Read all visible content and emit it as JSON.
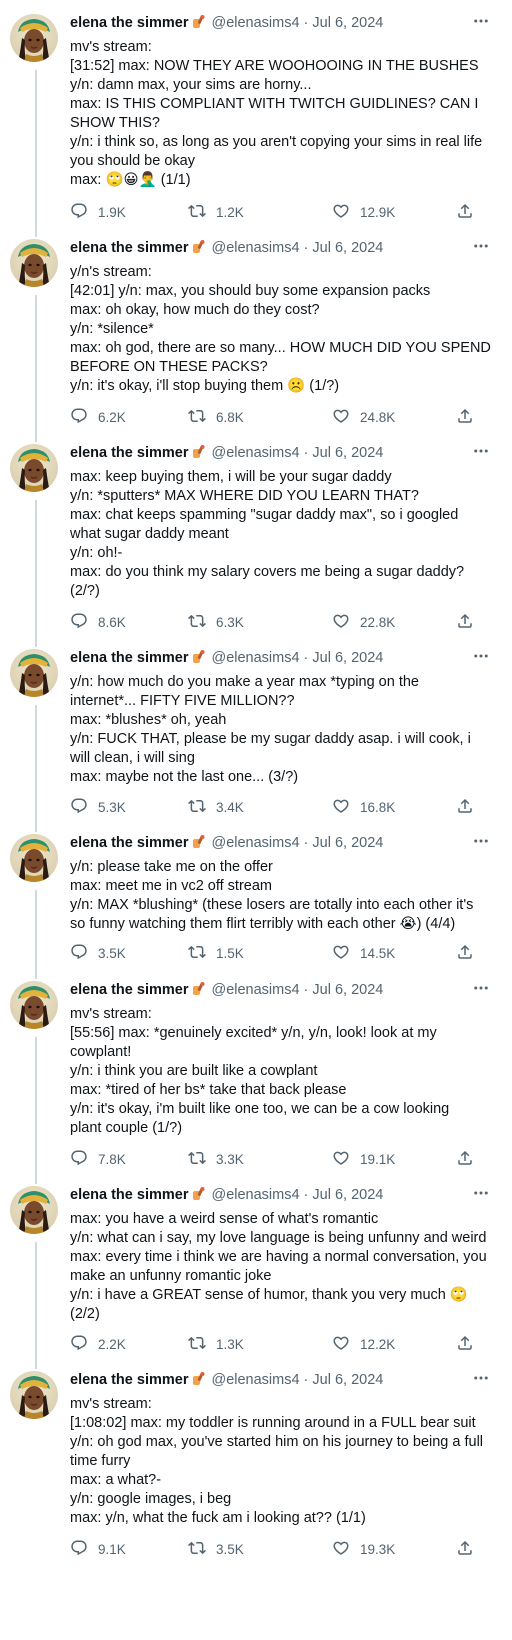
{
  "author": {
    "name": "elena the simmer",
    "handle": "@elenasims4",
    "date": "Jul 6, 2024",
    "separator": "·"
  },
  "tweets": [
    {
      "lines": [
        "mv's stream:",
        "[31:52] max: NOW THEY ARE WOOHOOING IN THE BUSHES",
        "y/n: damn max, your sims are horny...",
        "max: IS THIS COMPLIANT WITH TWITCH GUIDLINES? CAN I",
        "SHOW THIS?",
        "y/n: i think so, as long as you aren't copying your sims in real life",
        "you should be okay",
        "max: 🙄😀🤦‍♂️ (1/1)"
      ],
      "replies": "1.9K",
      "retweets": "1.2K",
      "likes": "12.9K"
    },
    {
      "lines": [
        "y/n's stream:",
        "[42:01] y/n: max, you should buy some expansion packs",
        "max: oh okay, how much do they cost?",
        "y/n: *silence*",
        "max: oh god, there are so many... HOW MUCH DID YOU SPEND",
        "BEFORE ON THESE PACKS?",
        "y/n: it's okay, i'll stop buying them ☹️ (1/?)"
      ],
      "replies": "6.2K",
      "retweets": "6.8K",
      "likes": "24.8K"
    },
    {
      "lines": [
        "max: keep buying them, i will be your sugar daddy",
        "y/n: *sputters* MAX WHERE DID YOU LEARN THAT?",
        "max: chat keeps spamming \"sugar daddy max\", so i googled",
        "what sugar daddy meant",
        "y/n: oh!-",
        "max: do you think my salary covers me being a sugar daddy?",
        "(2/?)"
      ],
      "replies": "8.6K",
      "retweets": "6.3K",
      "likes": "22.8K"
    },
    {
      "lines": [
        "y/n: how much do you make a year max *typing on the",
        "internet*... FIFTY FIVE MILLION??",
        "max: *blushes* oh, yeah",
        "y/n: FUCK THAT, please be my sugar daddy asap. i will cook, i",
        "will clean, i will sing",
        "max: maybe not the last one... (3/?)"
      ],
      "replies": "5.3K",
      "retweets": "3.4K",
      "likes": "16.8K"
    },
    {
      "lines": [
        "y/n: please take me on the offer",
        "max: meet me in vc2 off stream",
        "y/n: MAX *blushing* (these losers are totally into each other it's",
        "so funny watching them flirt terribly with each other 😭) (4/4)"
      ],
      "replies": "3.5K",
      "retweets": "1.5K",
      "likes": "14.5K"
    },
    {
      "lines": [
        "mv's stream:",
        "[55:56] max: *genuinely excited* y/n, y/n, look! look at my",
        "cowplant!",
        "y/n: i think you are built like a cowplant",
        "max: *tired of her bs* take that back please",
        "y/n: it's okay, i'm built like one too, we can be a cow looking",
        "plant couple (1/?)"
      ],
      "replies": "7.8K",
      "retweets": "3.3K",
      "likes": "19.1K"
    },
    {
      "lines": [
        "max: you have a weird sense of what's romantic",
        "y/n: what can i say, my love language is being unfunny and weird",
        "max: every time i think we are having a normal conversation, you",
        "make an unfunny romantic joke",
        "y/n: i have a GREAT sense of humor, thank you very much 🙄",
        "(2/2)"
      ],
      "replies": "2.2K",
      "retweets": "1.3K",
      "likes": "12.2K"
    },
    {
      "lines": [
        "mv's stream:",
        "[1:08:02] max: my toddler is running around in a FULL bear suit",
        "y/n: oh god max, you've started him on his journey to being a full",
        "time furry",
        "max: a what?-",
        "y/n: google images, i beg",
        "max: y/n, what the fuck am i looking at?? (1/1)"
      ],
      "replies": "9.1K",
      "retweets": "3.5K",
      "likes": "19.3K"
    }
  ],
  "icons": {
    "reply": "reply-icon",
    "retweet": "retweet-icon",
    "like": "heart-icon",
    "share": "share-icon",
    "more": "more-icon",
    "badge": "paintbrush-badge-icon"
  },
  "colors": {
    "text": "#0f1419",
    "muted": "#536471",
    "thread_line": "#cfd9de"
  }
}
